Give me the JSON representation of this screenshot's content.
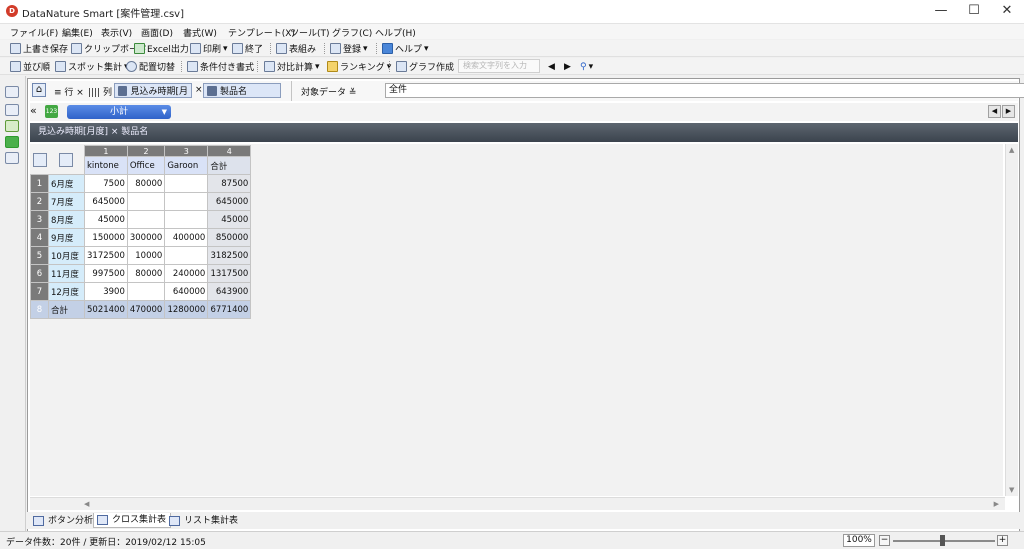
{
  "window": {
    "title": "DataNature Smart [案件管理.csv]",
    "app_icon_text": "D"
  },
  "menu": [
    "ファイル(F)",
    "編集(E)",
    "表示(V)",
    "画面(D)",
    "書式(W)",
    "テンプレート(X)",
    "ツール(T)",
    "グラフ(C)",
    "ヘルプ(H)"
  ],
  "toolbar1": {
    "save": "上書き保存",
    "clipboard": "クリップボード",
    "excel": "Excel出力",
    "print": "印刷",
    "exit": "終了",
    "table_layout": "表組み",
    "register": "登録",
    "help": "ヘルプ"
  },
  "toolbar2": {
    "sort": "並び順",
    "spot": "スポット集計",
    "layout_switch": "配置切替",
    "conditional": "条件付き書式",
    "compare": "対比計算",
    "ranking": "ランキング",
    "graph": "グラフ作成",
    "search_placeholder": "検索文字列を入力"
  },
  "filter": {
    "row_label": "行",
    "col_label": "列",
    "row_chip": "見込み時期[月",
    "col_chip": "製品名",
    "target_label": "対象データ",
    "target_value": "全件"
  },
  "subtotal_label": "小計",
  "breadcrumb": "見込み時期[月度] × 製品名",
  "table": {
    "col_numbers": [
      "1",
      "2",
      "3",
      "4"
    ],
    "col_headers": [
      "kintone",
      "Office",
      "Garoon",
      "合計"
    ],
    "rows": [
      {
        "n": "1",
        "label": "6月度",
        "values": [
          "7500",
          "80000",
          "",
          "87500"
        ]
      },
      {
        "n": "2",
        "label": "7月度",
        "values": [
          "645000",
          "",
          "",
          "645000"
        ]
      },
      {
        "n": "3",
        "label": "8月度",
        "values": [
          "45000",
          "",
          "",
          "45000"
        ]
      },
      {
        "n": "4",
        "label": "9月度",
        "values": [
          "150000",
          "300000",
          "400000",
          "850000"
        ]
      },
      {
        "n": "5",
        "label": "10月度",
        "values": [
          "3172500",
          "10000",
          "",
          "3182500"
        ]
      },
      {
        "n": "6",
        "label": "11月度",
        "values": [
          "997500",
          "80000",
          "240000",
          "1317500"
        ]
      },
      {
        "n": "7",
        "label": "12月度",
        "values": [
          "3900",
          "",
          "640000",
          "643900"
        ]
      }
    ],
    "total": {
      "n": "8",
      "label": "合計",
      "values": [
        "5021400",
        "470000",
        "1280000",
        "6771400"
      ]
    }
  },
  "tabs": [
    "ボタン分析",
    "クロス集計表",
    "リスト集計表"
  ],
  "status": {
    "text": "データ件数：20件 / 更新日：2019/02/12 15:05",
    "zoom": "100%"
  }
}
